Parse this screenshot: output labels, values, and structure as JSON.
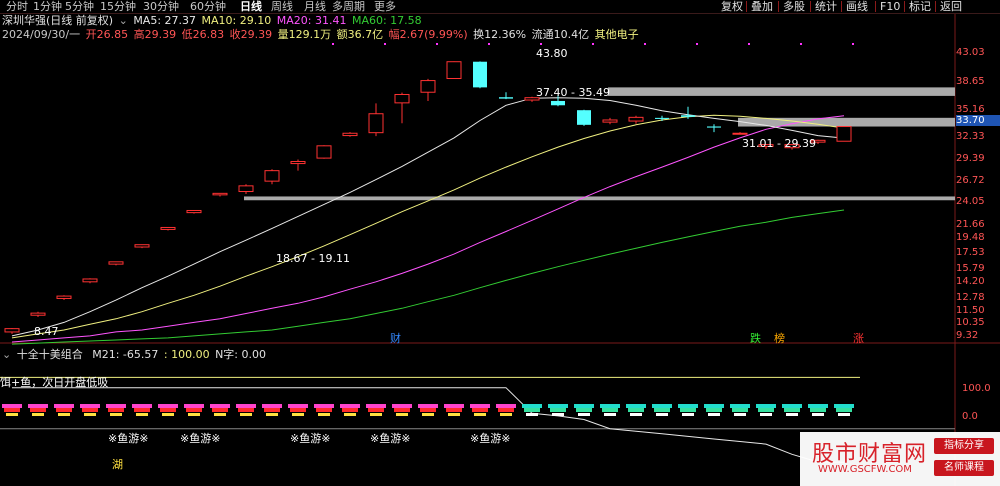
{
  "toolbar": {
    "timeframes": [
      "分时",
      "1分钟",
      "5分钟",
      "15分钟",
      "30分钟",
      "60分钟",
      "日线",
      "周线",
      "月线",
      "多周期",
      "更多"
    ],
    "active_timeframe": "日线",
    "right_buttons": [
      "复权",
      "叠加",
      "多股",
      "统计",
      "画线",
      "F10",
      "标记",
      "返回"
    ]
  },
  "main_info": {
    "stock_title": "深圳华强(日线 前复权)",
    "ma5_label": "MA5: 27.37",
    "ma10_label": "MA10: 29.10",
    "ma20_label": "MA20: 31.41",
    "ma60_label": "MA60: 17.58",
    "date": "2024/09/30/一",
    "open": "开26.85",
    "high": "高29.39",
    "low": "低26.83",
    "close": "收29.39",
    "volume": "量129.1万",
    "amount": "额36.7亿",
    "change": "幅2.67(9.99%)",
    "turnover": "换12.36%",
    "float_cap": "流通10.4亿",
    "sector": "其他电子"
  },
  "price_axis": {
    "labels": [
      "43.03",
      "38.65",
      "35.16",
      "32.33",
      "29.39",
      "26.72",
      "24.05",
      "21.66",
      "19.48",
      "17.53",
      "15.79",
      "14.20",
      "12.78",
      "11.50",
      "10.35",
      "9.32"
    ],
    "current_price": "33.70"
  },
  "annotations": {
    "peak_price": "43.80",
    "zone_high": "37.40 - 35.49",
    "zone_mid": "31.01 - 29.39",
    "zone_low": "18.67 - 19.11",
    "low_price": "8.47",
    "marker_cai": "财",
    "marker_die": "跌",
    "marker_bang": "榜",
    "marker_zhang": "涨"
  },
  "indicator": {
    "name": "十全十美组合",
    "m21": "M21: -65.57",
    "value": ": 100.00",
    "ntype": "N字: 0.00",
    "signal_text": "饵+鱼，次日开盘低吸",
    "tag_yuyou": "※鱼游※",
    "tag_hu": "湖",
    "axis_labels": [
      "100.0",
      "0.0"
    ]
  },
  "watermark": {
    "site": "股市财富网",
    "url": "WWW.GSCFW.COM",
    "btn1": "指标分享",
    "btn2": "名师课程"
  },
  "colors": {
    "up_red": "#ff3232",
    "down_cyan": "#54ffff",
    "ma5": "#e8e8e8",
    "ma10": "#f0f080",
    "ma20": "#ff55ff",
    "ma60": "#33cc33"
  },
  "chart_data": {
    "type": "candlestick",
    "y_scale": "log",
    "ylim": [
      8.4,
      46.5
    ],
    "candles": [
      {
        "o": 8.3,
        "h": 8.5,
        "l": 8.2,
        "c": 8.47
      },
      {
        "o": 9.2,
        "h": 9.4,
        "l": 9.1,
        "c": 9.32
      },
      {
        "o": 10.2,
        "h": 10.4,
        "l": 10.1,
        "c": 10.35
      },
      {
        "o": 11.3,
        "h": 11.55,
        "l": 11.2,
        "c": 11.5
      },
      {
        "o": 12.6,
        "h": 12.8,
        "l": 12.5,
        "c": 12.78
      },
      {
        "o": 14.0,
        "h": 14.2,
        "l": 13.9,
        "c": 14.2
      },
      {
        "o": 15.6,
        "h": 15.8,
        "l": 15.5,
        "c": 15.79
      },
      {
        "o": 17.3,
        "h": 17.55,
        "l": 17.2,
        "c": 17.53
      },
      {
        "o": 19.3,
        "h": 19.5,
        "l": 19.1,
        "c": 19.48
      },
      {
        "o": 19.7,
        "h": 20.6,
        "l": 19.4,
        "c": 20.4
      },
      {
        "o": 21.0,
        "h": 22.6,
        "l": 20.6,
        "c": 22.4
      },
      {
        "o": 23.4,
        "h": 24.0,
        "l": 22.4,
        "c": 23.7
      },
      {
        "o": 24.2,
        "h": 26.2,
        "l": 24.1,
        "c": 26.1
      },
      {
        "o": 27.8,
        "h": 28.4,
        "l": 27.6,
        "c": 28.2
      },
      {
        "o": 28.3,
        "h": 33.9,
        "l": 27.7,
        "c": 31.8
      },
      {
        "o": 34.0,
        "h": 36.2,
        "l": 30.0,
        "c": 35.8
      },
      {
        "o": 36.3,
        "h": 39.4,
        "l": 34.4,
        "c": 39.0
      },
      {
        "o": 39.5,
        "h": 43.9,
        "l": 39.5,
        "c": 43.8
      },
      {
        "o": 43.8,
        "h": 43.9,
        "l": 37.2,
        "c": 37.4
      },
      {
        "o": 35.2,
        "h": 36.3,
        "l": 34.8,
        "c": 34.9
      },
      {
        "o": 34.6,
        "h": 35.3,
        "l": 34.2,
        "c": 35.1
      },
      {
        "o": 34.4,
        "h": 35.7,
        "l": 33.3,
        "c": 33.5
      },
      {
        "o": 32.5,
        "h": 32.6,
        "l": 29.5,
        "c": 29.7
      },
      {
        "o": 30.2,
        "h": 31.0,
        "l": 29.8,
        "c": 30.6
      },
      {
        "o": 30.4,
        "h": 31.4,
        "l": 29.9,
        "c": 31.1
      },
      {
        "o": 31.0,
        "h": 31.4,
        "l": 30.4,
        "c": 30.8
      },
      {
        "o": 31.5,
        "h": 33.2,
        "l": 30.8,
        "c": 31.2
      },
      {
        "o": 29.4,
        "h": 29.8,
        "l": 28.4,
        "c": 29.2
      },
      {
        "o": 28.2,
        "h": 28.4,
        "l": 28.0,
        "c": 28.2
      },
      {
        "o": 26.0,
        "h": 26.4,
        "l": 25.6,
        "c": 26.3
      },
      {
        "o": 25.8,
        "h": 26.3,
        "l": 25.5,
        "c": 26.3
      },
      {
        "o": 26.7,
        "h": 27.1,
        "l": 26.4,
        "c": 27.0
      },
      {
        "o": 26.85,
        "h": 29.39,
        "l": 26.83,
        "c": 29.39
      }
    ],
    "ma5": [
      8.1,
      8.4,
      8.8,
      9.4,
      10.1,
      10.9,
      11.7,
      12.6,
      13.6,
      14.6,
      15.7,
      16.9,
      18.2,
      19.6,
      21.2,
      23.0,
      25.1,
      27.4,
      30.5,
      33.5,
      35.0,
      35.1,
      35.0,
      34.5,
      33.5,
      32.4,
      31.6,
      30.9,
      30.3,
      29.6,
      28.7,
      27.8,
      27.37
    ],
    "ma10": [
      8.0,
      8.2,
      8.4,
      8.7,
      9.0,
      9.4,
      9.9,
      10.4,
      11.0,
      11.7,
      12.4,
      13.2,
      14.1,
      15.1,
      16.2,
      17.4,
      18.6,
      19.9,
      21.4,
      22.9,
      24.4,
      25.9,
      27.3,
      28.6,
      29.7,
      30.6,
      31.2,
      31.5,
      31.3,
      30.9,
      30.4,
      29.8,
      29.1
    ],
    "ma20": [
      7.8,
      7.9,
      8.0,
      8.1,
      8.3,
      8.4,
      8.6,
      8.8,
      9.0,
      9.3,
      9.6,
      9.9,
      10.3,
      10.8,
      11.3,
      11.9,
      12.6,
      13.4,
      14.4,
      15.4,
      16.5,
      17.7,
      19.0,
      20.3,
      21.6,
      22.9,
      24.3,
      25.9,
      27.4,
      28.9,
      29.9,
      30.8,
      31.41
    ],
    "ma60": [
      7.7,
      7.75,
      7.8,
      7.85,
      7.9,
      7.95,
      8.0,
      8.1,
      8.2,
      8.3,
      8.4,
      8.6,
      8.8,
      9.0,
      9.3,
      9.6,
      10.0,
      10.4,
      10.9,
      11.4,
      11.9,
      12.4,
      12.9,
      13.4,
      13.9,
      14.4,
      14.9,
      15.4,
      15.9,
      16.3,
      16.8,
      17.2,
      17.58
    ],
    "zones": [
      {
        "low": 35.49,
        "high": 37.4
      },
      {
        "low": 29.39,
        "high": 31.01
      },
      {
        "low": 18.67,
        "high": 19.11
      }
    ],
    "indicator_line": [
      80,
      80,
      80,
      80,
      80,
      80,
      80,
      80,
      80,
      80,
      80,
      80,
      80,
      80,
      80,
      80,
      80,
      80,
      80,
      80,
      30,
      25,
      18,
      0,
      -5,
      -10,
      -15,
      -20,
      -25,
      -30,
      -50,
      -65,
      -65.57
    ],
    "indicator_ylim": [
      -100,
      130
    ]
  }
}
